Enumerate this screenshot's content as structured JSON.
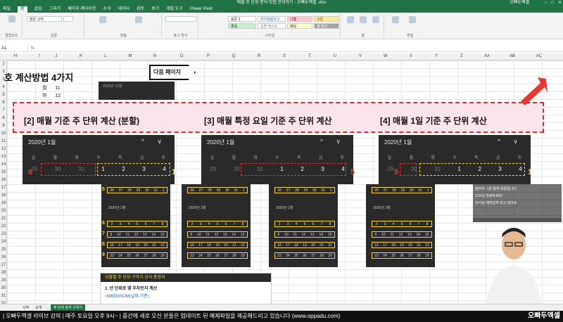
{
  "window": {
    "title": "매월 주 단위 분석 방법 분리하기 - 오빠두엑셀 .xlsx",
    "search": "검색",
    "user": "오빠두엑셀",
    "controls": [
      "–",
      "□",
      "✕"
    ]
  },
  "ribbon": {
    "tabs": [
      "파일",
      "홈",
      "삽입",
      "그리기",
      "페이지 레이아웃",
      "수식",
      "데이터",
      "검토",
      "보기",
      "개발 도구",
      "Power Pivot"
    ],
    "active_tab": "홈",
    "font_name": "맑은 고딕",
    "groups": [
      "클립보드",
      "글꼴",
      "맞춤",
      "표시 형식",
      "스타일",
      "셀",
      "편집"
    ],
    "styles": [
      "표준 2",
      "하이퍼링크 2",
      "나쁨",
      "보통",
      "좋음",
      "설명 텍스트",
      "메모",
      "셀 확인"
    ]
  },
  "formula_bar": {
    "name_box": "A1",
    "fx": "fx"
  },
  "columns": [
    "H",
    "I",
    "J",
    "K",
    "L",
    "M",
    "N",
    "O",
    "P",
    "Q",
    "R",
    "S",
    "T",
    "U",
    "V",
    "W",
    "X",
    "Y",
    "Z",
    "AA",
    "AB",
    "AC"
  ],
  "rows": [
    "1",
    "2",
    "3",
    "4",
    "5",
    "6",
    "7",
    "8",
    "9",
    "10",
    "11",
    "12",
    "13",
    "14",
    "15",
    "16",
    "17",
    "18",
    "19",
    "20",
    "21",
    "22",
    "23",
    "24",
    "25",
    "26",
    "27",
    "28",
    "29",
    "30",
    "31",
    "32",
    "33"
  ],
  "sheet": {
    "section_title": "호 계산방법 4가지",
    "next_button": "다음 페이지",
    "cells": [
      {
        "label": "월",
        "value": "11"
      },
      {
        "label": "하",
        "value": "12"
      }
    ],
    "small_calendar_title": "2020년 12월",
    "methods": [
      "[2] 매월 기준 주 단위 계산 (분할)",
      "[3] 매월 특정 요일 기준 주 단위 계산",
      "[4] 매월 1일 기준 주 단위 계산"
    ]
  },
  "calendars": [
    {
      "title": "2020년 1월",
      "nav": "^ ∨",
      "dow": [
        "일",
        "월",
        "화",
        "수",
        "목",
        "금",
        "토"
      ],
      "days": [
        "29",
        "30",
        "31",
        "1",
        "2",
        "3",
        "4"
      ],
      "left_num": "6",
      "right_num": "1"
    },
    {
      "title": "2020년 1월",
      "nav": "^ ∨",
      "dow": [
        "일",
        "월",
        "화",
        "수",
        "목",
        "금",
        "토"
      ],
      "days": [
        "29",
        "30",
        "31",
        "1",
        "2",
        "3",
        "4"
      ],
      "left_num": "",
      "right_num": "5"
    },
    {
      "title": "2020년 1월",
      "nav": "^ ∨",
      "dow": [
        "일",
        "월",
        "화",
        "수",
        "목",
        "금",
        "토"
      ],
      "days": [
        "29",
        "30",
        "31",
        "1",
        "2",
        "3",
        "4"
      ],
      "left_num": "5",
      "right_num": "1"
    }
  ],
  "week_calendars": {
    "month_label": "2020년 2월",
    "weeks": [
      [
        "26",
        "27",
        "28",
        "29",
        "30",
        "31",
        "1"
      ],
      [
        "2",
        "3",
        "4",
        "5",
        "6",
        "7",
        "8"
      ],
      [
        "9",
        "10",
        "11",
        "12",
        "13",
        "14",
        "15"
      ],
      [
        "16",
        "17",
        "18",
        "19",
        "20",
        "21",
        "22"
      ],
      [
        "23",
        "24",
        "25",
        "26",
        "27",
        "28",
        "29"
      ]
    ],
    "week_numbers": [
      "5",
      "6",
      "7",
      "8",
      "9"
    ]
  },
  "panel": {
    "header": "상황별 주 단위 구하기 공식 총정리",
    "line1": "1. 년 단위로 몇 주차인지 계산",
    "line2": "=WEEKNUM(날짜,기준)"
  },
  "chat": [
    "참여자: 1회 참여 회원입니다",
    "꼬꼬님 안녕하세요!",
    "강사님 재미있게 보고 있어요"
  ],
  "sheet_tabs": [
    "시작",
    "소개",
    "...",
    "주 단위 분석 구하기"
  ],
  "ticker": "| 오빠두엑셀 라이브 강의 | 매주 토요일 오후 9시~ | 중간에 새로 오신 분들은 업데이트 된 예제파일을 제공해드리고 있습니다 (www.oppadu.com)",
  "logo": "오빠두엑셀"
}
